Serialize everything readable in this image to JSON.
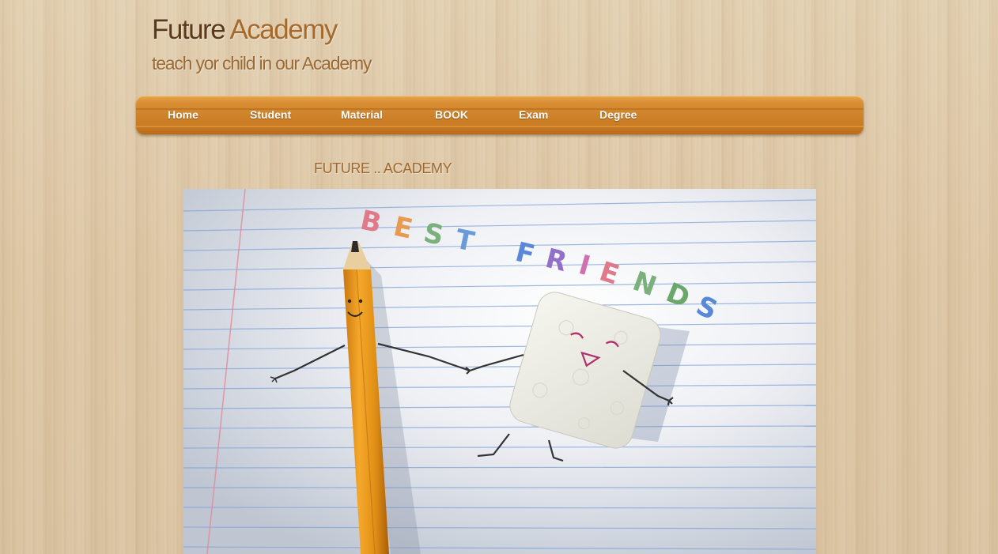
{
  "header": {
    "title_word1": "Future",
    "title_word2": "Academy",
    "tagline": "teach yor child in our Academy"
  },
  "nav": {
    "items": [
      {
        "label": "Home"
      },
      {
        "label": "Student"
      },
      {
        "label": "Material"
      },
      {
        "label": "BOOK"
      },
      {
        "label": "Exam"
      },
      {
        "label": "Degree"
      }
    ]
  },
  "main": {
    "heading": "FUTURE .. ACADEMY",
    "hero_image": {
      "text": "BEST FRIENDS",
      "colors": {
        "letters": [
          "#e06a6a",
          "#e89a50",
          "#6aa86a",
          "#5a8ad8",
          "#a070c8"
        ]
      }
    }
  },
  "colors": {
    "nav_background": "#d98e33",
    "title_dark": "#5a3a1c",
    "title_accent": "#a56a2c",
    "page_background": "#dcc6a4"
  }
}
